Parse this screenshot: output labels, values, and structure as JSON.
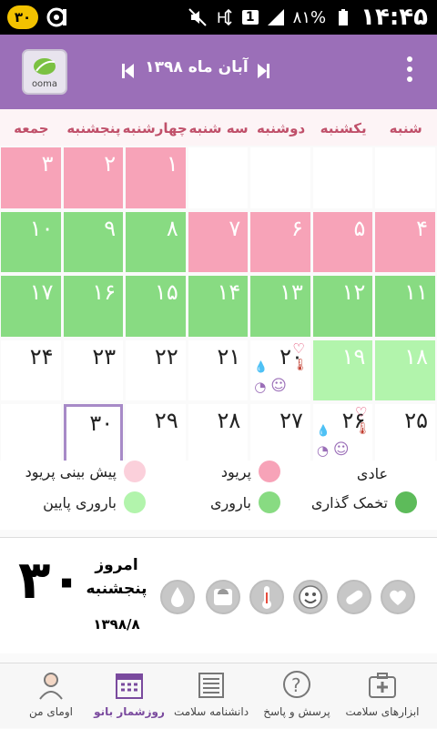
{
  "status_bar": {
    "badge": "۳۰",
    "battery_pct": "٨١%",
    "time": "۱۴:۴۵",
    "sim_label": "1"
  },
  "header": {
    "logo_text": "ooma",
    "month_title": "آبان ماه ۱۳۹۸"
  },
  "weekdays": [
    "شنبه",
    "یکشنبه",
    "دوشنبه",
    "سه شنبه",
    "چهارشنبه",
    "پنجشنبه",
    "جمعه"
  ],
  "calendar": {
    "rows": [
      [
        {
          "n": "",
          "t": "plain"
        },
        {
          "n": "",
          "t": "plain"
        },
        {
          "n": "",
          "t": "plain"
        },
        {
          "n": "",
          "t": "plain"
        },
        {
          "n": "۱",
          "t": "pink"
        },
        {
          "n": "۲",
          "t": "pink"
        },
        {
          "n": "۳",
          "t": "pink"
        }
      ],
      [
        {
          "n": "۴",
          "t": "pink"
        },
        {
          "n": "۵",
          "t": "pink"
        },
        {
          "n": "۶",
          "t": "pink"
        },
        {
          "n": "۷",
          "t": "pink"
        },
        {
          "n": "۸",
          "t": "green"
        },
        {
          "n": "۹",
          "t": "green"
        },
        {
          "n": "۱۰",
          "t": "green"
        }
      ],
      [
        {
          "n": "۱۱",
          "t": "green"
        },
        {
          "n": "۱۲",
          "t": "green"
        },
        {
          "n": "۱۳",
          "t": "green"
        },
        {
          "n": "۱۴",
          "t": "green"
        },
        {
          "n": "۱۵",
          "t": "green"
        },
        {
          "n": "۱۶",
          "t": "green"
        },
        {
          "n": "۱۷",
          "t": "green"
        }
      ],
      [
        {
          "n": "۱۸",
          "t": "lgreen"
        },
        {
          "n": "۱۹",
          "t": "lgreen"
        },
        {
          "n": "۲۰",
          "t": "plain",
          "icons": true
        },
        {
          "n": "۲۱",
          "t": "plain"
        },
        {
          "n": "۲۲",
          "t": "plain"
        },
        {
          "n": "۲۳",
          "t": "plain"
        },
        {
          "n": "۲۴",
          "t": "plain"
        }
      ],
      [
        {
          "n": "۲۵",
          "t": "plain"
        },
        {
          "n": "۲۶",
          "t": "plain",
          "icons": true
        },
        {
          "n": "۲۷",
          "t": "plain"
        },
        {
          "n": "۲۸",
          "t": "plain"
        },
        {
          "n": "۲۹",
          "t": "plain"
        },
        {
          "n": "۳۰",
          "t": "plain",
          "today": true
        },
        {
          "n": "",
          "t": "plain"
        }
      ]
    ]
  },
  "legend": {
    "normal": "عادی",
    "period": "پریود",
    "period_forecast": "پیش بینی پریود",
    "ovulation": "تخمک گذاری",
    "fertile": "باروری",
    "low_fertile": "باروری پایین"
  },
  "colors": {
    "normal": "#ffffff",
    "period": "#f7a3b8",
    "period_forecast": "#fbd0db",
    "ovulation": "#5dbb5a",
    "fertile": "#88db82",
    "low_fertile": "#b2f4ac",
    "accent": "#9b6fb8"
  },
  "today": {
    "big_number": "۳۰",
    "label": "امروز",
    "weekday": "پنجشنبه",
    "date": "۱۳۹۸/۸"
  },
  "today_tools": [
    "water-drop-icon",
    "scale-icon",
    "thermometer-icon",
    "smiley-icon",
    "pill-icon",
    "heart-icon"
  ],
  "bottom_nav": [
    {
      "label": "ابزارهای سلامت",
      "icon": "first-aid-icon"
    },
    {
      "label": "پرسش و پاسخ",
      "icon": "question-icon"
    },
    {
      "label": "دانشنامه سلامت",
      "icon": "encyclopedia-icon"
    },
    {
      "label": "روزشمار بانو",
      "icon": "calendar-icon"
    },
    {
      "label": "اومای من",
      "icon": "profile-icon"
    }
  ]
}
